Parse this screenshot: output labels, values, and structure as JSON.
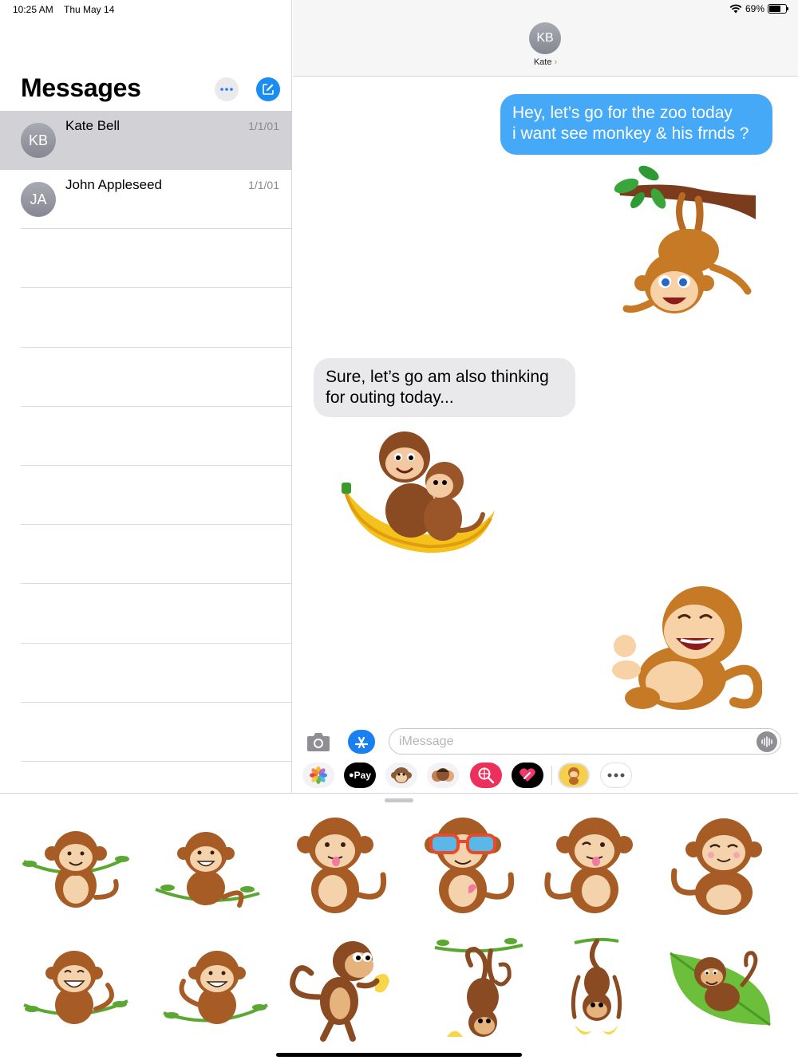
{
  "status_bar": {
    "time": "10:25 AM",
    "date": "Thu May 14",
    "battery_percent": "69%",
    "battery_level": 0.69
  },
  "sidebar": {
    "title": "Messages",
    "conversations": [
      {
        "initials": "KB",
        "name": "Kate Bell",
        "date": "1/1/01",
        "selected": true
      },
      {
        "initials": "JA",
        "name": "John Appleseed",
        "date": "1/1/01",
        "selected": false
      }
    ]
  },
  "conversation": {
    "contact_initials": "KB",
    "contact_name": "Kate",
    "messages": [
      {
        "direction": "outgoing",
        "text": "Hey, let’s go for the zoo today\ni want see monkey & his frnds ?"
      },
      {
        "direction": "outgoing",
        "sticker": "monkey-hanging-branch"
      },
      {
        "direction": "incoming",
        "text": "Sure, let’s go am also thinking\nfor outing today..."
      },
      {
        "direction": "incoming",
        "sticker": "monkeys-on-banana"
      },
      {
        "direction": "outgoing",
        "sticker": "monkey-laughing"
      }
    ]
  },
  "compose": {
    "placeholder": "iMessage"
  },
  "app_drawer": {
    "apps": [
      "photos-app",
      "apple-pay-app",
      "animoji-app",
      "memoji-app",
      "web-images-app",
      "digital-touch-app",
      "monkey-sticker-app",
      "more-apps"
    ],
    "apple_pay_label": "Pay",
    "selected_app": "monkey-sticker-app"
  },
  "stickers": [
    "monkey-sitting-vine",
    "monkey-grinning-vine",
    "monkey-tongue-out",
    "monkey-sunglasses",
    "monkey-winking",
    "monkey-sleepy",
    "monkey-laughing-vine",
    "monkey-smiling-vine",
    "monkey-eating-banana",
    "monkey-hanging-vine",
    "monkey-hanging-bananas",
    "monkey-on-leaf"
  ]
}
